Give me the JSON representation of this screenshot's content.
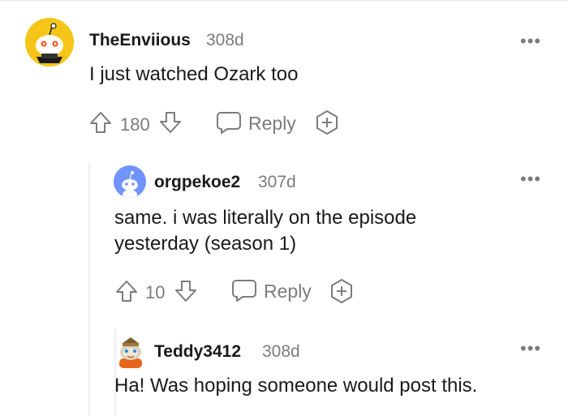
{
  "comments": [
    {
      "username": "TheEnviious",
      "age": "308d",
      "body": "I just watched Ozark too",
      "score": "180",
      "reply_label": "Reply",
      "more_label": "•••"
    },
    {
      "username": "orgpekoe2",
      "age": "307d",
      "body_line1": "same. i was literally on the episode",
      "body_line2": "yesterday (season 1)",
      "score": "10",
      "reply_label": "Reply",
      "more_label": "•••"
    },
    {
      "username": "Teddy3412",
      "age": "308d",
      "body": "Ha! Was hoping someone would post this.",
      "more_label": "•••"
    }
  ],
  "icons": {
    "upvote": "arrow-up-icon",
    "downvote": "arrow-down-icon",
    "reply": "speech-bubble-icon",
    "award": "plus-award-icon",
    "more": "more-options-icon"
  },
  "colors": {
    "text": "#1a1a1b",
    "meta": "#7c7c7c",
    "avatar_yellow": "#f5c518",
    "avatar_blue": "#7193ff"
  }
}
